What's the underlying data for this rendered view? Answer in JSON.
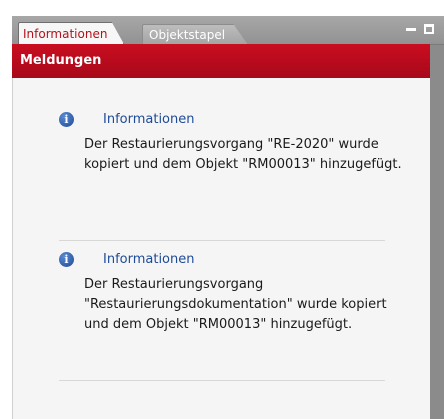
{
  "tabs": [
    {
      "label": "Informationen",
      "active": true
    },
    {
      "label": "Objektstapel",
      "active": false
    }
  ],
  "panel": {
    "title": "Meldungen"
  },
  "messages": [
    {
      "icon": "info-icon",
      "title": "Informationen",
      "text": "Der Restaurierungsvorgang \"RE-2020\" wurde kopiert und dem Objekt \"RM00013\" hinzugefügt."
    },
    {
      "icon": "info-icon",
      "title": "Informationen",
      "text": "Der Restaurierungsvorgang \"Restaurierungsdokumentation\" wurde kopiert und dem Objekt \"RM00013\" hinzugefügt."
    }
  ],
  "colors": {
    "header": "#b4121b",
    "info": "#1d4b98",
    "active_tab_text": "#b4121b"
  }
}
